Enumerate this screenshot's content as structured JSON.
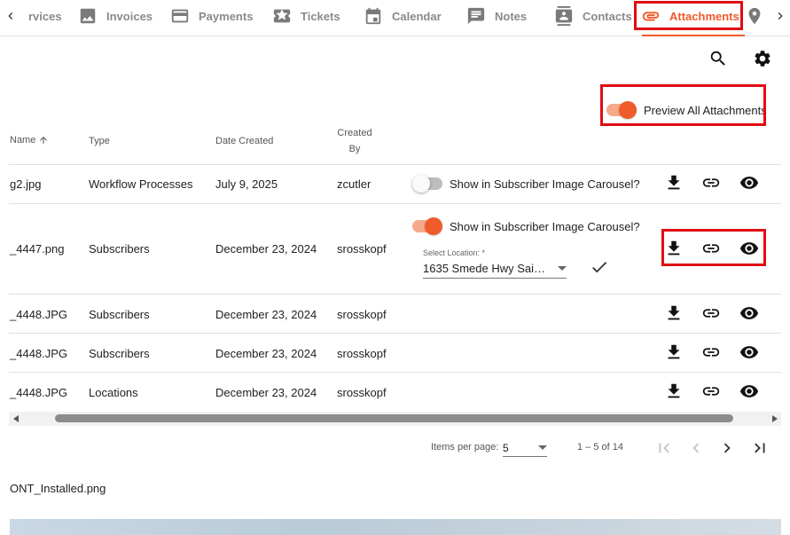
{
  "tabs": [
    {
      "label": "rvices",
      "icon": "services-icon"
    },
    {
      "label": "Invoices",
      "icon": "image-icon"
    },
    {
      "label": "Payments",
      "icon": "credit-card-icon"
    },
    {
      "label": "Tickets",
      "icon": "ticket-icon"
    },
    {
      "label": "Calendar",
      "icon": "calendar-icon"
    },
    {
      "label": "Notes",
      "icon": "notes-icon"
    },
    {
      "label": "Contacts",
      "icon": "contacts-icon"
    },
    {
      "label": "Attachments",
      "icon": "paperclip-icon",
      "active": true
    },
    {
      "label": "",
      "icon": "location-pin-icon"
    }
  ],
  "toolbar": {
    "search": "search-icon",
    "settings": "gear-icon",
    "preview_all_label": "Preview All Attachments",
    "preview_all_on": true
  },
  "table": {
    "headers": {
      "name": "Name",
      "type": "Type",
      "date_created": "Date Created",
      "created_by_line1": "Created",
      "created_by_line2": "By"
    },
    "carousel_label": "Show in Subscriber Image Carousel?",
    "location_label": "Select Location: *",
    "rows": [
      {
        "name": "g2.jpg",
        "type": "Workflow Processes",
        "date": "July 9, 2025",
        "by": "zcutler",
        "carousel": true,
        "carousel_on": false
      },
      {
        "name": "_4447.png",
        "type": "Subscribers",
        "date": "December 23, 2024",
        "by": "srosskopf",
        "carousel": true,
        "carousel_on": true,
        "location": "1635 Smede Hwy Saint ..."
      },
      {
        "name": "_4448.JPG",
        "type": "Subscribers",
        "date": "December 23, 2024",
        "by": "srosskopf",
        "carousel": false
      },
      {
        "name": "_4448.JPG",
        "type": "Subscribers",
        "date": "December 23, 2024",
        "by": "srosskopf",
        "carousel": false
      },
      {
        "name": "_4448.JPG",
        "type": "Locations",
        "date": "December 23, 2024",
        "by": "srosskopf",
        "carousel": false
      }
    ],
    "actions": [
      "download-icon",
      "link-icon",
      "eye-icon"
    ]
  },
  "paginator": {
    "items_per_page_label": "Items per page:",
    "page_size": "5",
    "range": "1 – 5 of 14"
  },
  "preview": {
    "file_name": "ONT_Installed.png"
  },
  "colors": {
    "accent": "#ef5b2b",
    "highlight": "#e00d12"
  }
}
